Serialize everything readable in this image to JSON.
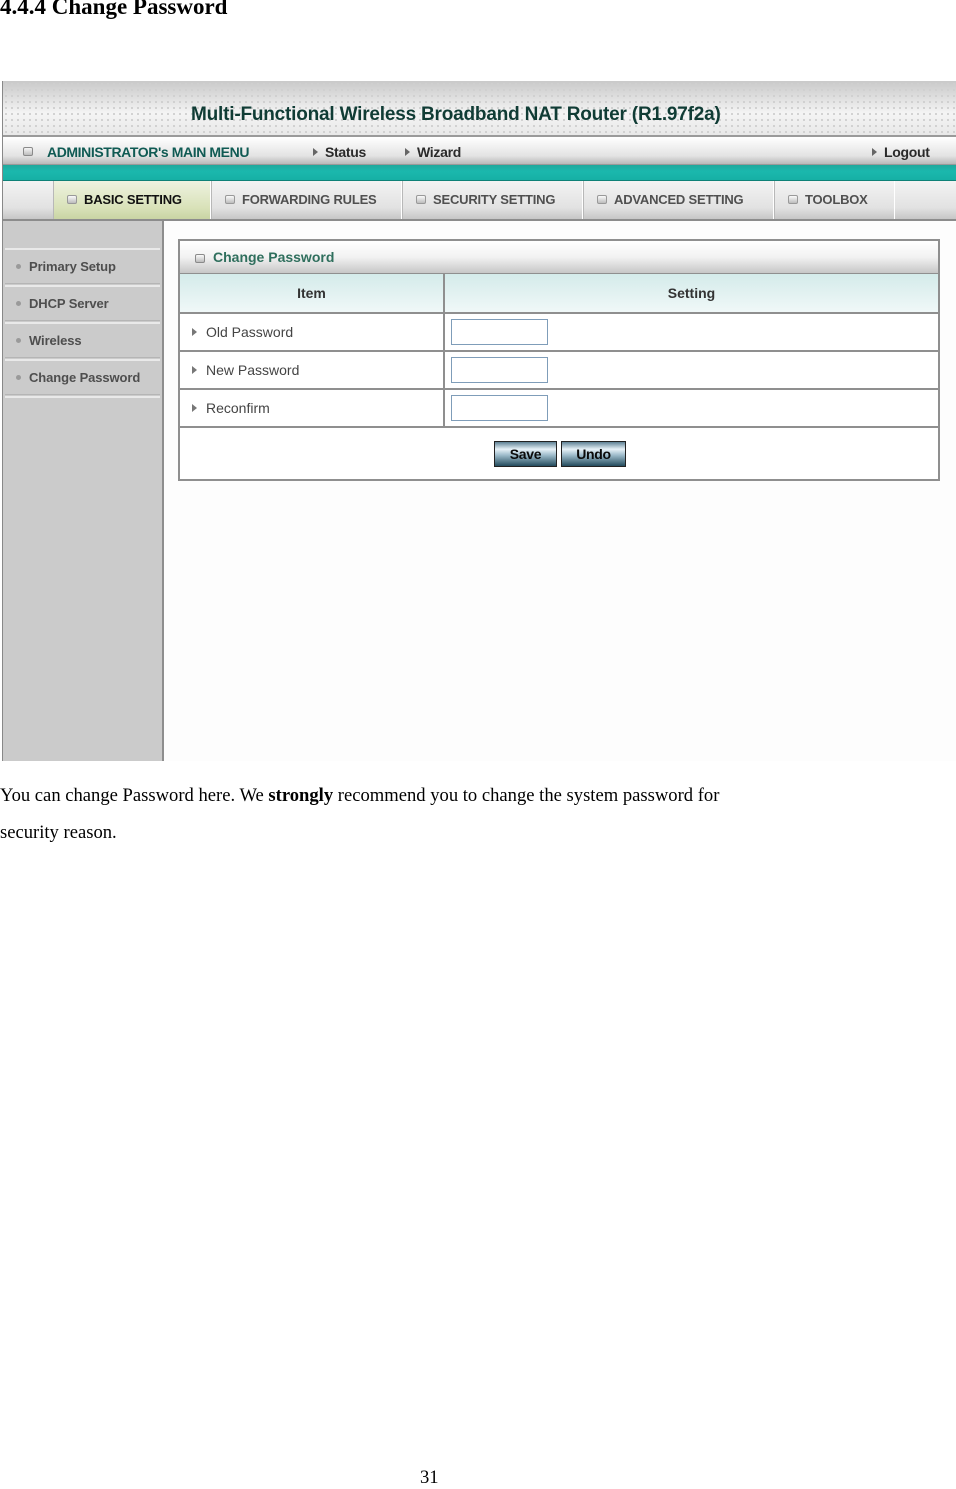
{
  "document": {
    "section_heading": "4.4.4 Change Password",
    "paragraph": {
      "before": "You can change Password here. We ",
      "emphasis": "strongly",
      "after": " recommend you to change the system password for",
      "line2": "security reason."
    },
    "page_number": "31"
  },
  "router_ui": {
    "banner_title": "Multi-Functional Wireless Broadband NAT Router (R1.97f2a)",
    "menu": {
      "admin_label": "ADMINISTRATOR's MAIN MENU",
      "links": [
        "Status",
        "Wizard",
        "Logout"
      ]
    },
    "tabs": [
      {
        "label": "BASIC SETTING",
        "active": true
      },
      {
        "label": "FORWARDING RULES",
        "active": false
      },
      {
        "label": "SECURITY SETTING",
        "active": false
      },
      {
        "label": "ADVANCED SETTING",
        "active": false
      },
      {
        "label": "TOOLBOX",
        "active": false
      }
    ],
    "sidebar": {
      "items": [
        "Primary Setup",
        "DHCP Server",
        "Wireless",
        "Change Password"
      ]
    },
    "panel": {
      "title": "Change Password",
      "columns": [
        "Item",
        "Setting"
      ],
      "rows": [
        {
          "label": "Old Password",
          "value": ""
        },
        {
          "label": "New Password",
          "value": ""
        },
        {
          "label": "Reconfirm",
          "value": ""
        }
      ],
      "buttons": {
        "save": "Save",
        "undo": "Undo"
      }
    },
    "colors": {
      "teal_bar": "#1bb8ad",
      "heading_text": "#103c35",
      "active_tab": "#d9e2b9",
      "sidebar_bg": "#cbcbcb",
      "table_header": "#d4ebea",
      "panel_title": "#2f6f5d"
    }
  }
}
